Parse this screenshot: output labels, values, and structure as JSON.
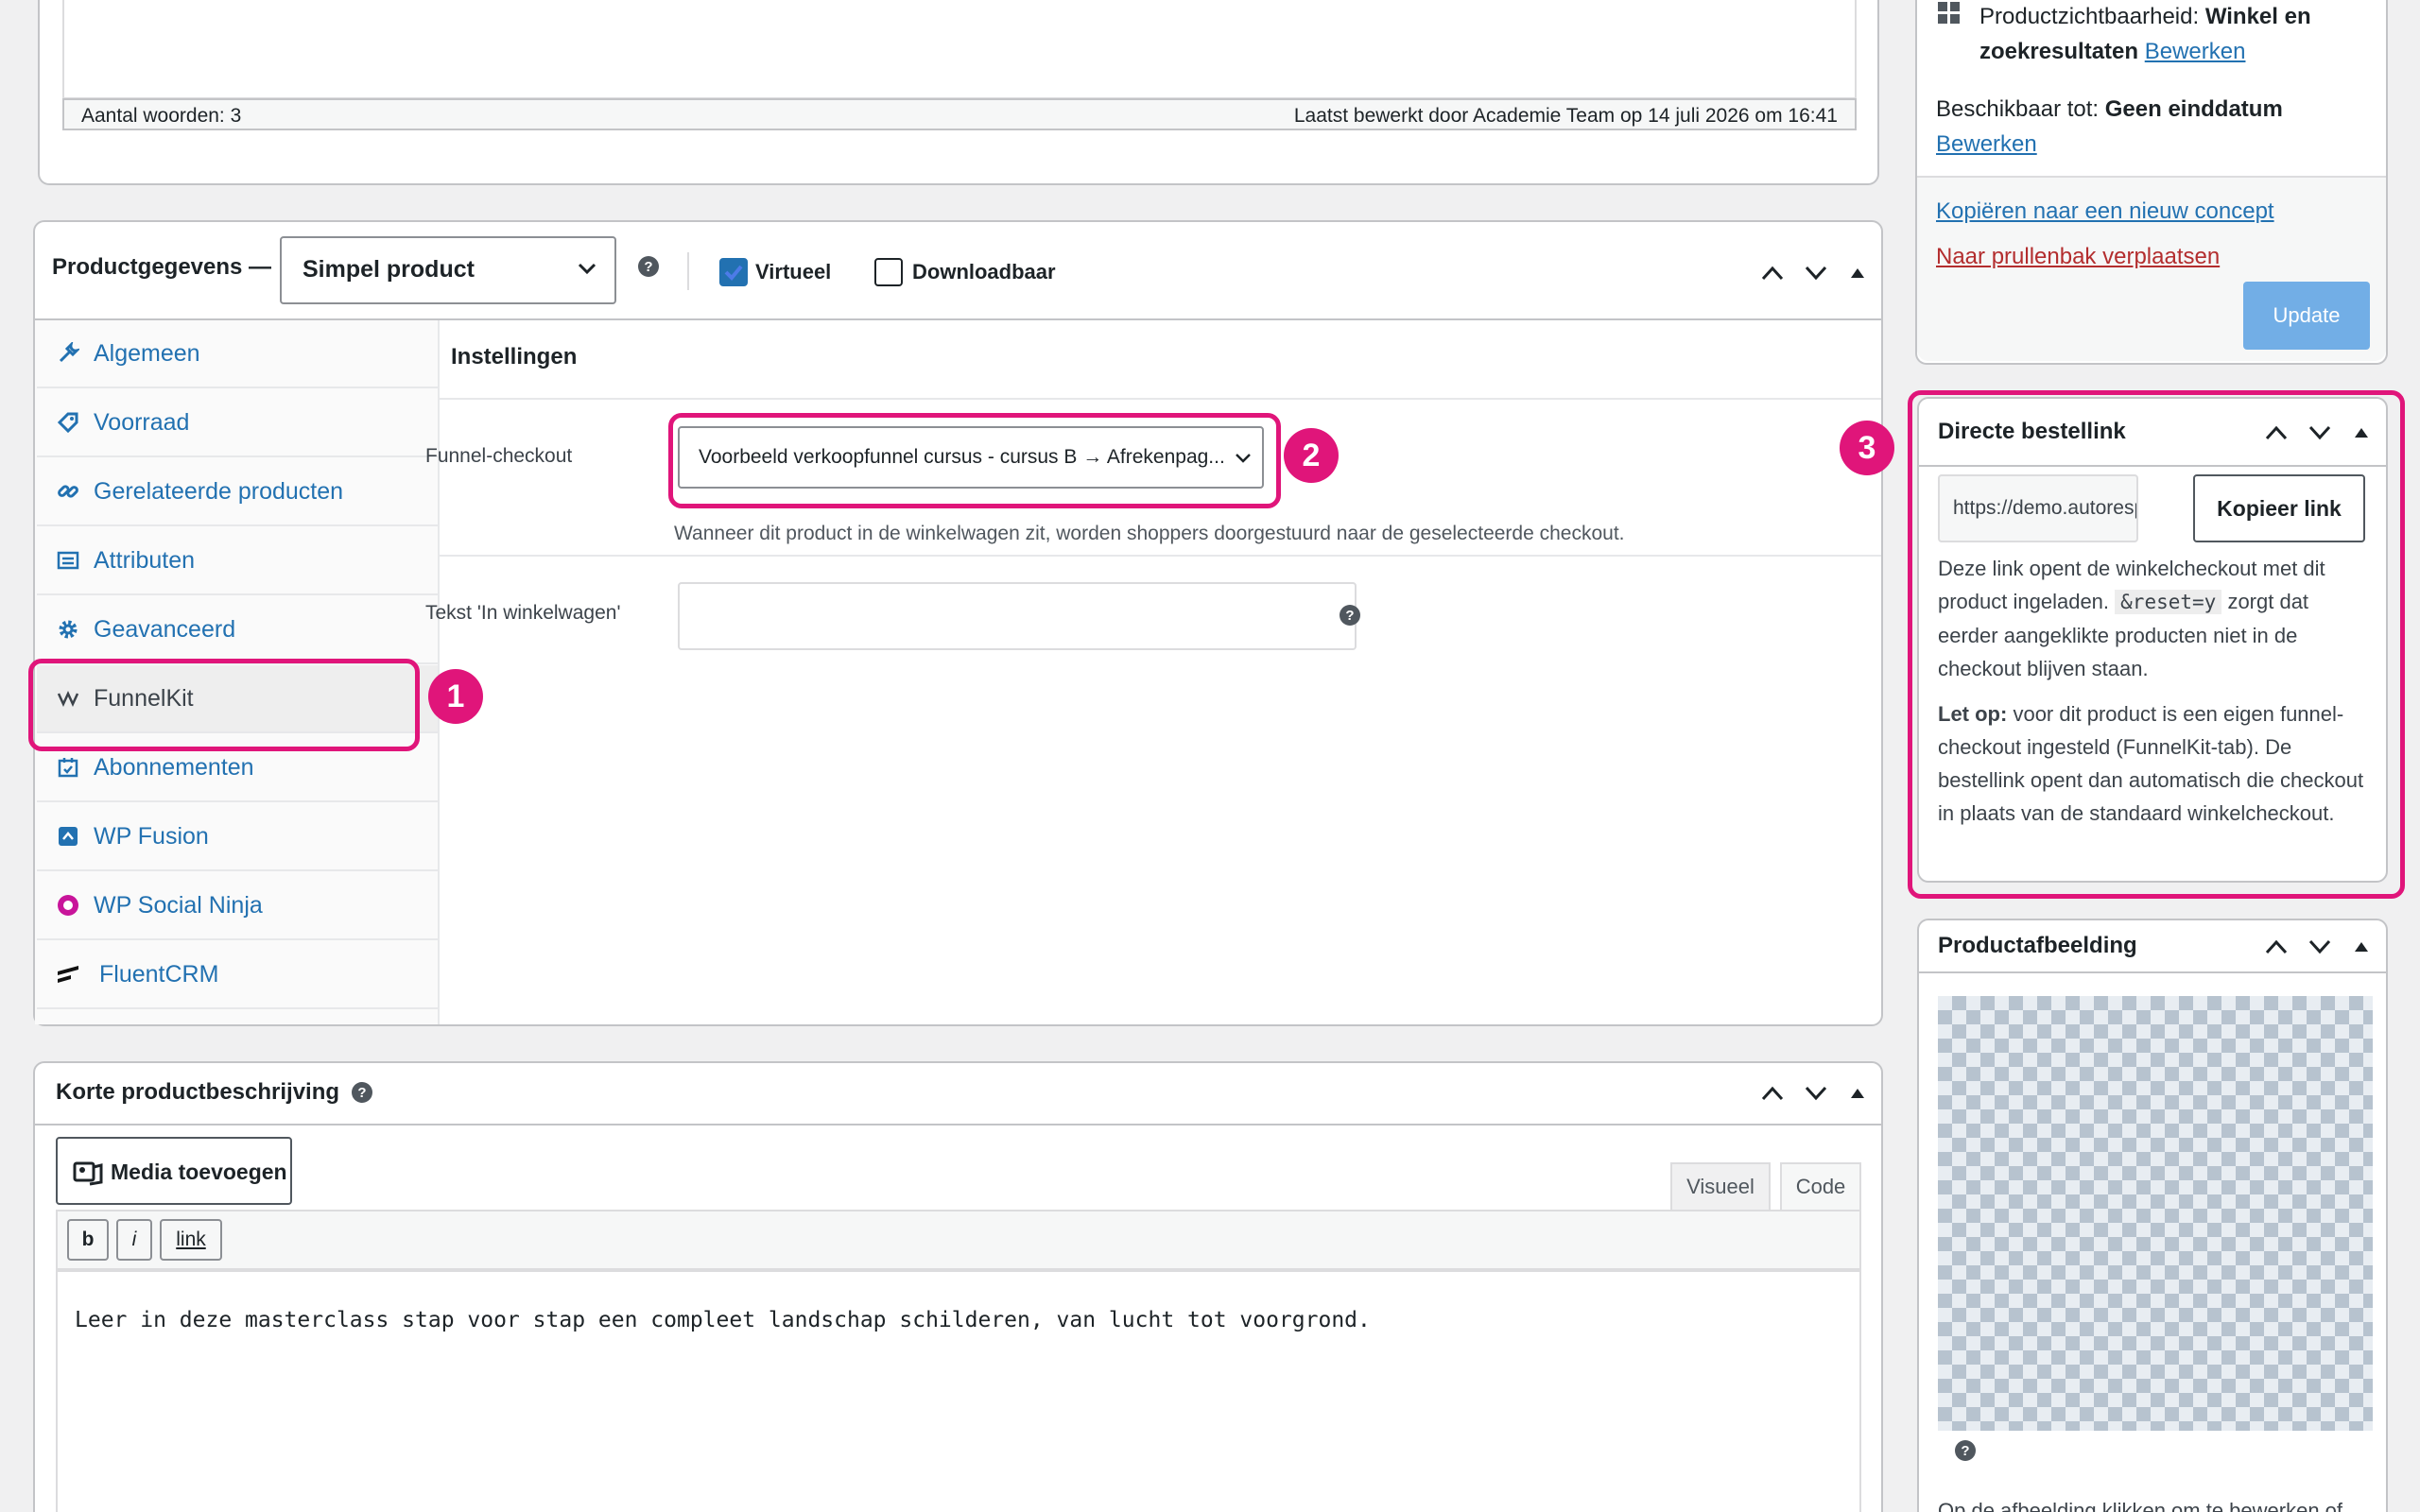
{
  "editor_top": {
    "word_count": "Aantal woorden: 3",
    "last_edited": "Laatst bewerkt door Academie Team op 14 juli 2026 om 16:41"
  },
  "product_data": {
    "title": "Productgegevens —",
    "type_value": "Simpel product",
    "virtual_label": "Virtueel",
    "virtual_checked": true,
    "downloadable_label": "Downloadbaar",
    "downloadable_checked": false,
    "tabs": [
      {
        "label": "Algemeen",
        "icon": "wrench-icon"
      },
      {
        "label": "Voorraad",
        "icon": "tag-icon"
      },
      {
        "label": "Gerelateerde producten",
        "icon": "link-icon"
      },
      {
        "label": "Attributen",
        "icon": "list-icon"
      },
      {
        "label": "Geavanceerd",
        "icon": "gear-icon"
      },
      {
        "label": "FunnelKit",
        "icon": "funnelkit-icon"
      },
      {
        "label": "Abonnementen",
        "icon": "calendar-icon"
      },
      {
        "label": "WP Fusion",
        "icon": "wp-fusion-icon"
      },
      {
        "label": "WP Social Ninja",
        "icon": "social-ninja-icon"
      },
      {
        "label": "FluentCRM",
        "icon": "fluentcrm-icon"
      }
    ],
    "settings_title": "Instellingen",
    "funnel_label": "Funnel-checkout",
    "funnel_value": "Voorbeeld verkoopfunnel cursus - cursus B → Afrekenpag...",
    "funnel_help": "Wanneer dit product in de winkelwagen zit, worden shoppers doorgestuurd naar de geselecteerde checkout.",
    "cart_text_label": "Tekst 'In winkelwagen'",
    "cart_text_value": ""
  },
  "short_desc": {
    "title": "Korte productbeschrijving",
    "media_button": "Media toevoegen",
    "tab_visual": "Visueel",
    "tab_code": "Code",
    "btn_b": "b",
    "btn_i": "i",
    "btn_link": "link",
    "content": "Leer in deze masterclass stap voor stap een compleet landschap schilderen, van lucht tot voorgrond."
  },
  "publish": {
    "visibility_label": "Productzichtbaarheid:",
    "visibility_value_1": "Winkel en",
    "visibility_value_2": "zoekresultaten",
    "visibility_edit": "Bewerken",
    "available_label": "Beschikbaar tot:",
    "available_value": "Geen einddatum",
    "available_edit": "Bewerken",
    "copy_draft": "Kopiëren naar een nieuw concept",
    "trash": "Naar prullenbak verplaatsen",
    "update": "Update"
  },
  "direct_link": {
    "title": "Directe bestellink",
    "url": "https://demo.autoresponder.nl/winkelmand/?add-to-cart=&reset=y",
    "copy_button": "Kopieer link",
    "desc_1": "Deze link opent de winkelcheckout met dit product ingeladen.",
    "code": "&reset=y",
    "desc_2": "zorgt dat eerder aangeklikte producten niet in de checkout blijven staan.",
    "note_bold": "Let op:",
    "note": "voor dit product is een eigen funnel-checkout ingesteld (FunnelKit-tab). De bestellink opent dan automatisch die checkout in plaats van de standaard winkelcheckout."
  },
  "product_image": {
    "title": "Productafbeelding",
    "caption": "Op de afbeelding klikken om te bewerken of"
  },
  "annotations": [
    "1",
    "2",
    "3"
  ],
  "colors": {
    "accent": "#e0157a",
    "link": "#2271b1",
    "update_button": "#72aee6",
    "trash": "#b32d2e"
  }
}
